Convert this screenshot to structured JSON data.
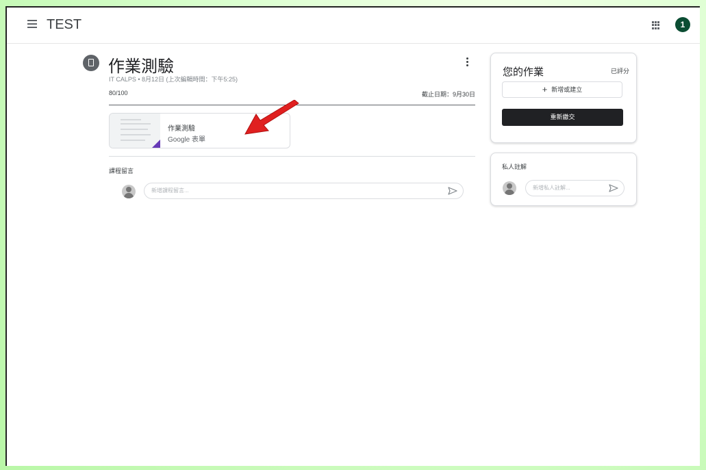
{
  "header": {
    "class_name": "TEST",
    "avatar_letter": "1"
  },
  "assignment": {
    "title": "作業測驗",
    "meta": "IT CALPS • 8月12日 (上次編輯時間：下午5:25)",
    "points": "80/100",
    "due": "截止日期：9月30日",
    "attachment": {
      "title": "作業測驗",
      "type": "Google 表單"
    }
  },
  "comments": {
    "label": "課程留言",
    "placeholder": "新增課程留言..."
  },
  "your_work": {
    "title": "您的作業",
    "status": "已評分",
    "add_label": "新增或建立",
    "add_icon": "+",
    "resubmit_label": "重新繳交"
  },
  "private_comments": {
    "title": "私人註解",
    "placeholder": "新增私人註解..."
  },
  "colors": {
    "avatar_bg": "#0b4d33",
    "forms_accent": "#673ab7",
    "annotation_arrow": "#e02020"
  }
}
